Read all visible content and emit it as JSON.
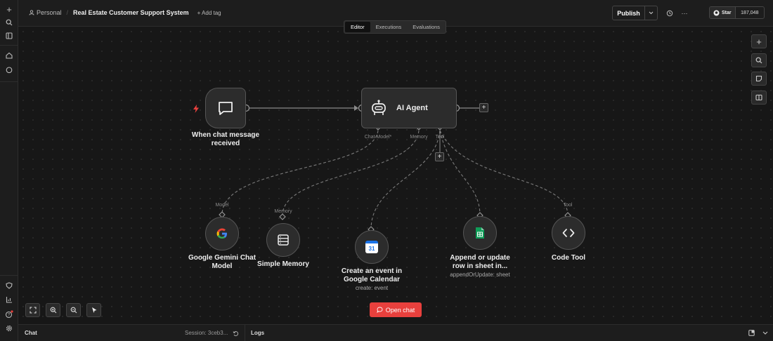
{
  "header": {
    "breadcrumb_project": "Personal",
    "workflow_name": "Real Estate Customer Support System",
    "add_tag": "+ Add tag",
    "publish_label": "Publish",
    "more": "···",
    "star_label": "Star",
    "star_count": "187,048"
  },
  "tabs": {
    "editor": "Editor",
    "executions": "Executions",
    "evaluations": "Evaluations"
  },
  "nodes": {
    "trigger": {
      "line1": "When chat message",
      "line2": "received"
    },
    "agent": {
      "title": "AI Agent",
      "slot_chat_model": "Chat Model*",
      "slot_memory": "Memory",
      "slot_tool": "Tool"
    },
    "gemini": {
      "line1": "Google Gemini Chat",
      "line2": "Model",
      "conn": "Model"
    },
    "memory": {
      "title": "Simple Memory",
      "conn": "Memory"
    },
    "calendar": {
      "line1": "Create an event in",
      "line2": "Google Calendar",
      "sub": "create: event",
      "icon_text": "31"
    },
    "sheets": {
      "line1": "Append or update",
      "line2": "row in sheet in...",
      "sub": "appendOrUpdate: sheet"
    },
    "code": {
      "title": "Code Tool",
      "conn": "Tool"
    }
  },
  "open_chat_label": "Open chat",
  "bottom": {
    "chat": "Chat",
    "session": "Session: 3ceb3...",
    "logs": "Logs"
  },
  "colors": {
    "accent_red": "#e8403d",
    "canvas": "#171717",
    "node_bg": "#2c2c2c"
  }
}
